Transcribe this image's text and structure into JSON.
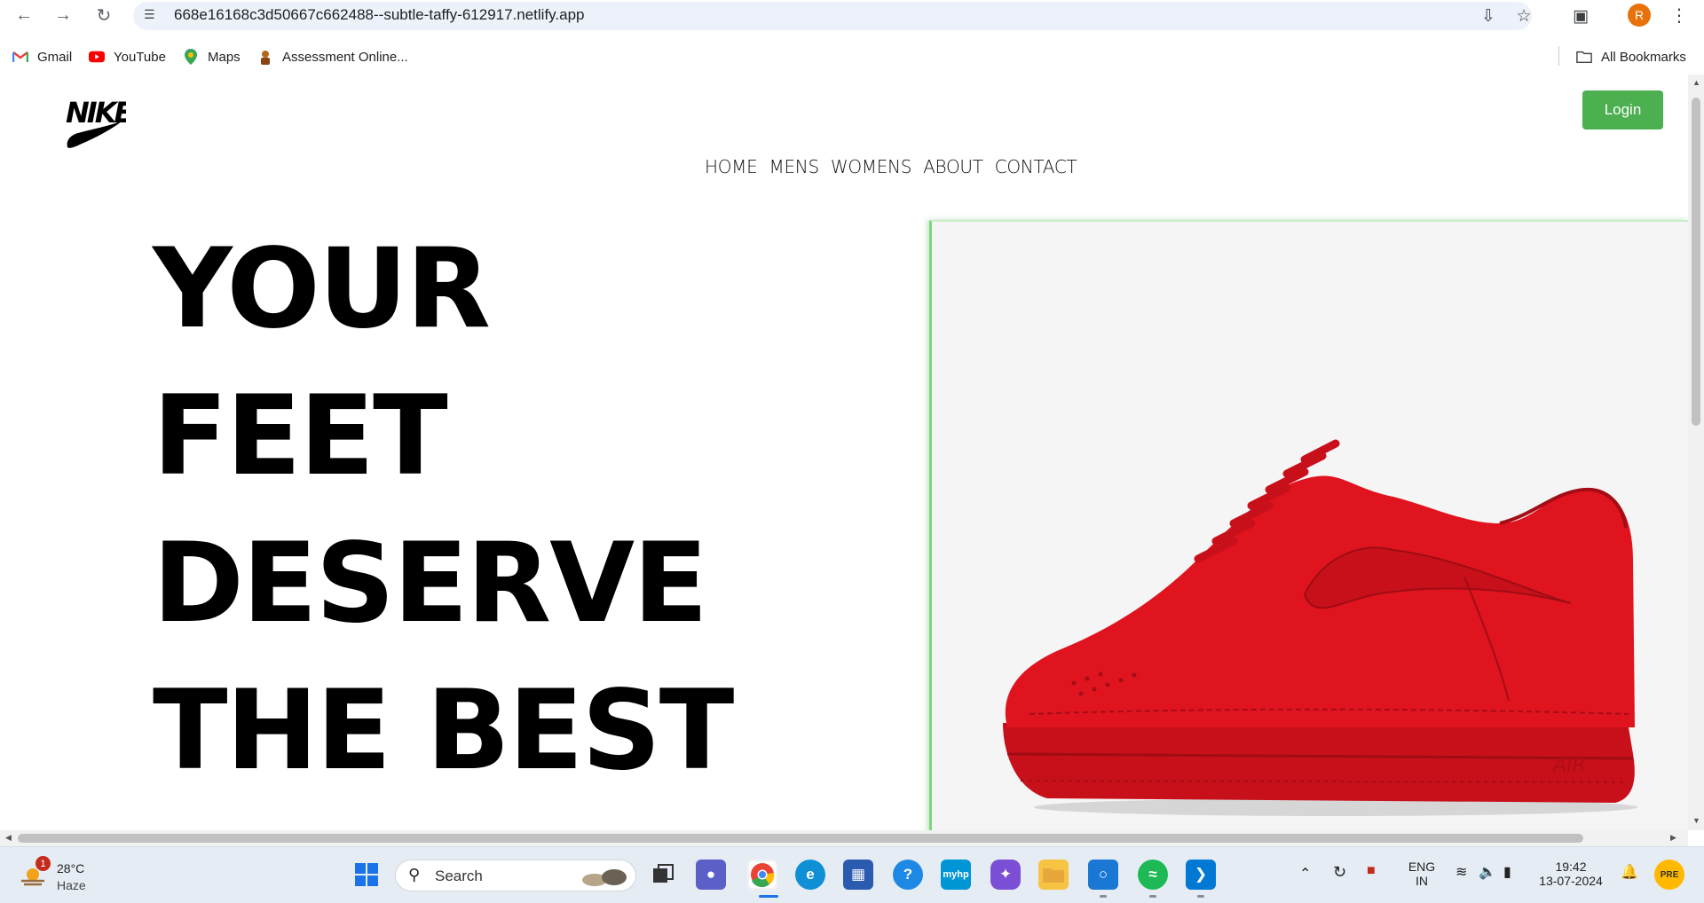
{
  "browser": {
    "url": "668e16168c3d50667c662488--subtle-taffy-612917.netlify.app",
    "profile_initial": "R",
    "bookmarks": [
      {
        "label": "Gmail",
        "icon": "gmail-icon"
      },
      {
        "label": "YouTube",
        "icon": "youtube-icon"
      },
      {
        "label": "Maps",
        "icon": "maps-icon"
      },
      {
        "label": "Assessment Online...",
        "icon": "assessment-icon"
      }
    ],
    "all_bookmarks_label": "All Bookmarks"
  },
  "site": {
    "logo_icon": "nike-logo-icon",
    "login_label": "Login",
    "nav": [
      "HOME",
      "MENS",
      "WOMENS",
      "ABOUT",
      "CONTACT"
    ],
    "hero_lines": [
      "YOUR",
      "FEET",
      "DESERVE",
      "THE BEST"
    ],
    "hero_image": "red-sneaker-image",
    "colors": {
      "login_bg": "#4caf50",
      "sneaker_red": "#e0141f",
      "image_bg": "#f5f5f5"
    }
  },
  "taskbar": {
    "weather_temp": "28°C",
    "weather_desc": "Haze",
    "weather_badge": "1",
    "search_label": "Search",
    "language_line1": "ENG",
    "language_line2": "IN",
    "time": "19:42",
    "date": "13-07-2024"
  }
}
